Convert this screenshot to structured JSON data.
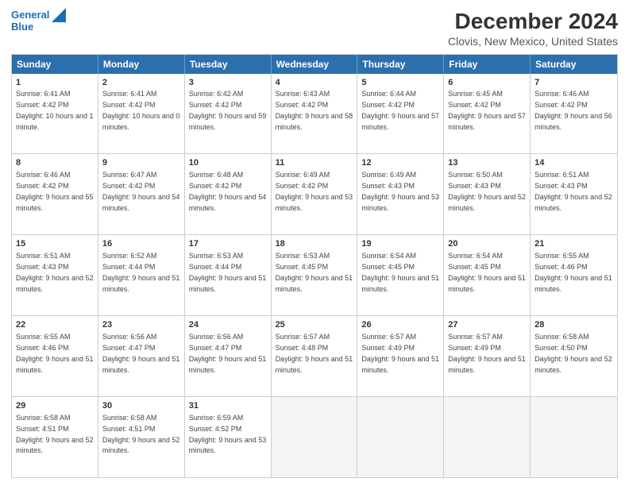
{
  "header": {
    "logo_line1": "General",
    "logo_line2": "Blue",
    "title": "December 2024",
    "subtitle": "Clovis, New Mexico, United States"
  },
  "days": [
    "Sunday",
    "Monday",
    "Tuesday",
    "Wednesday",
    "Thursday",
    "Friday",
    "Saturday"
  ],
  "weeks": [
    [
      {
        "day": "1",
        "sunrise": "6:41 AM",
        "sunset": "4:42 PM",
        "daylight": "10 hours and 1 minute."
      },
      {
        "day": "2",
        "sunrise": "6:41 AM",
        "sunset": "4:42 PM",
        "daylight": "10 hours and 0 minutes."
      },
      {
        "day": "3",
        "sunrise": "6:42 AM",
        "sunset": "4:42 PM",
        "daylight": "9 hours and 59 minutes."
      },
      {
        "day": "4",
        "sunrise": "6:43 AM",
        "sunset": "4:42 PM",
        "daylight": "9 hours and 58 minutes."
      },
      {
        "day": "5",
        "sunrise": "6:44 AM",
        "sunset": "4:42 PM",
        "daylight": "9 hours and 57 minutes."
      },
      {
        "day": "6",
        "sunrise": "6:45 AM",
        "sunset": "4:42 PM",
        "daylight": "9 hours and 57 minutes."
      },
      {
        "day": "7",
        "sunrise": "6:46 AM",
        "sunset": "4:42 PM",
        "daylight": "9 hours and 56 minutes."
      }
    ],
    [
      {
        "day": "8",
        "sunrise": "6:46 AM",
        "sunset": "4:42 PM",
        "daylight": "9 hours and 55 minutes."
      },
      {
        "day": "9",
        "sunrise": "6:47 AM",
        "sunset": "4:42 PM",
        "daylight": "9 hours and 54 minutes."
      },
      {
        "day": "10",
        "sunrise": "6:48 AM",
        "sunset": "4:42 PM",
        "daylight": "9 hours and 54 minutes."
      },
      {
        "day": "11",
        "sunrise": "6:49 AM",
        "sunset": "4:42 PM",
        "daylight": "9 hours and 53 minutes."
      },
      {
        "day": "12",
        "sunrise": "6:49 AM",
        "sunset": "4:43 PM",
        "daylight": "9 hours and 53 minutes."
      },
      {
        "day": "13",
        "sunrise": "6:50 AM",
        "sunset": "4:43 PM",
        "daylight": "9 hours and 52 minutes."
      },
      {
        "day": "14",
        "sunrise": "6:51 AM",
        "sunset": "4:43 PM",
        "daylight": "9 hours and 52 minutes."
      }
    ],
    [
      {
        "day": "15",
        "sunrise": "6:51 AM",
        "sunset": "4:43 PM",
        "daylight": "9 hours and 52 minutes."
      },
      {
        "day": "16",
        "sunrise": "6:52 AM",
        "sunset": "4:44 PM",
        "daylight": "9 hours and 51 minutes."
      },
      {
        "day": "17",
        "sunrise": "6:53 AM",
        "sunset": "4:44 PM",
        "daylight": "9 hours and 51 minutes."
      },
      {
        "day": "18",
        "sunrise": "6:53 AM",
        "sunset": "4:45 PM",
        "daylight": "9 hours and 51 minutes."
      },
      {
        "day": "19",
        "sunrise": "6:54 AM",
        "sunset": "4:45 PM",
        "daylight": "9 hours and 51 minutes."
      },
      {
        "day": "20",
        "sunrise": "6:54 AM",
        "sunset": "4:45 PM",
        "daylight": "9 hours and 51 minutes."
      },
      {
        "day": "21",
        "sunrise": "6:55 AM",
        "sunset": "4:46 PM",
        "daylight": "9 hours and 51 minutes."
      }
    ],
    [
      {
        "day": "22",
        "sunrise": "6:55 AM",
        "sunset": "4:46 PM",
        "daylight": "9 hours and 51 minutes."
      },
      {
        "day": "23",
        "sunrise": "6:56 AM",
        "sunset": "4:47 PM",
        "daylight": "9 hours and 51 minutes."
      },
      {
        "day": "24",
        "sunrise": "6:56 AM",
        "sunset": "4:47 PM",
        "daylight": "9 hours and 51 minutes."
      },
      {
        "day": "25",
        "sunrise": "6:57 AM",
        "sunset": "4:48 PM",
        "daylight": "9 hours and 51 minutes."
      },
      {
        "day": "26",
        "sunrise": "6:57 AM",
        "sunset": "4:49 PM",
        "daylight": "9 hours and 51 minutes."
      },
      {
        "day": "27",
        "sunrise": "6:57 AM",
        "sunset": "4:49 PM",
        "daylight": "9 hours and 51 minutes."
      },
      {
        "day": "28",
        "sunrise": "6:58 AM",
        "sunset": "4:50 PM",
        "daylight": "9 hours and 52 minutes."
      }
    ],
    [
      {
        "day": "29",
        "sunrise": "6:58 AM",
        "sunset": "4:51 PM",
        "daylight": "9 hours and 52 minutes."
      },
      {
        "day": "30",
        "sunrise": "6:58 AM",
        "sunset": "4:51 PM",
        "daylight": "9 hours and 52 minutes."
      },
      {
        "day": "31",
        "sunrise": "6:59 AM",
        "sunset": "4:52 PM",
        "daylight": "9 hours and 53 minutes."
      },
      null,
      null,
      null,
      null
    ]
  ]
}
